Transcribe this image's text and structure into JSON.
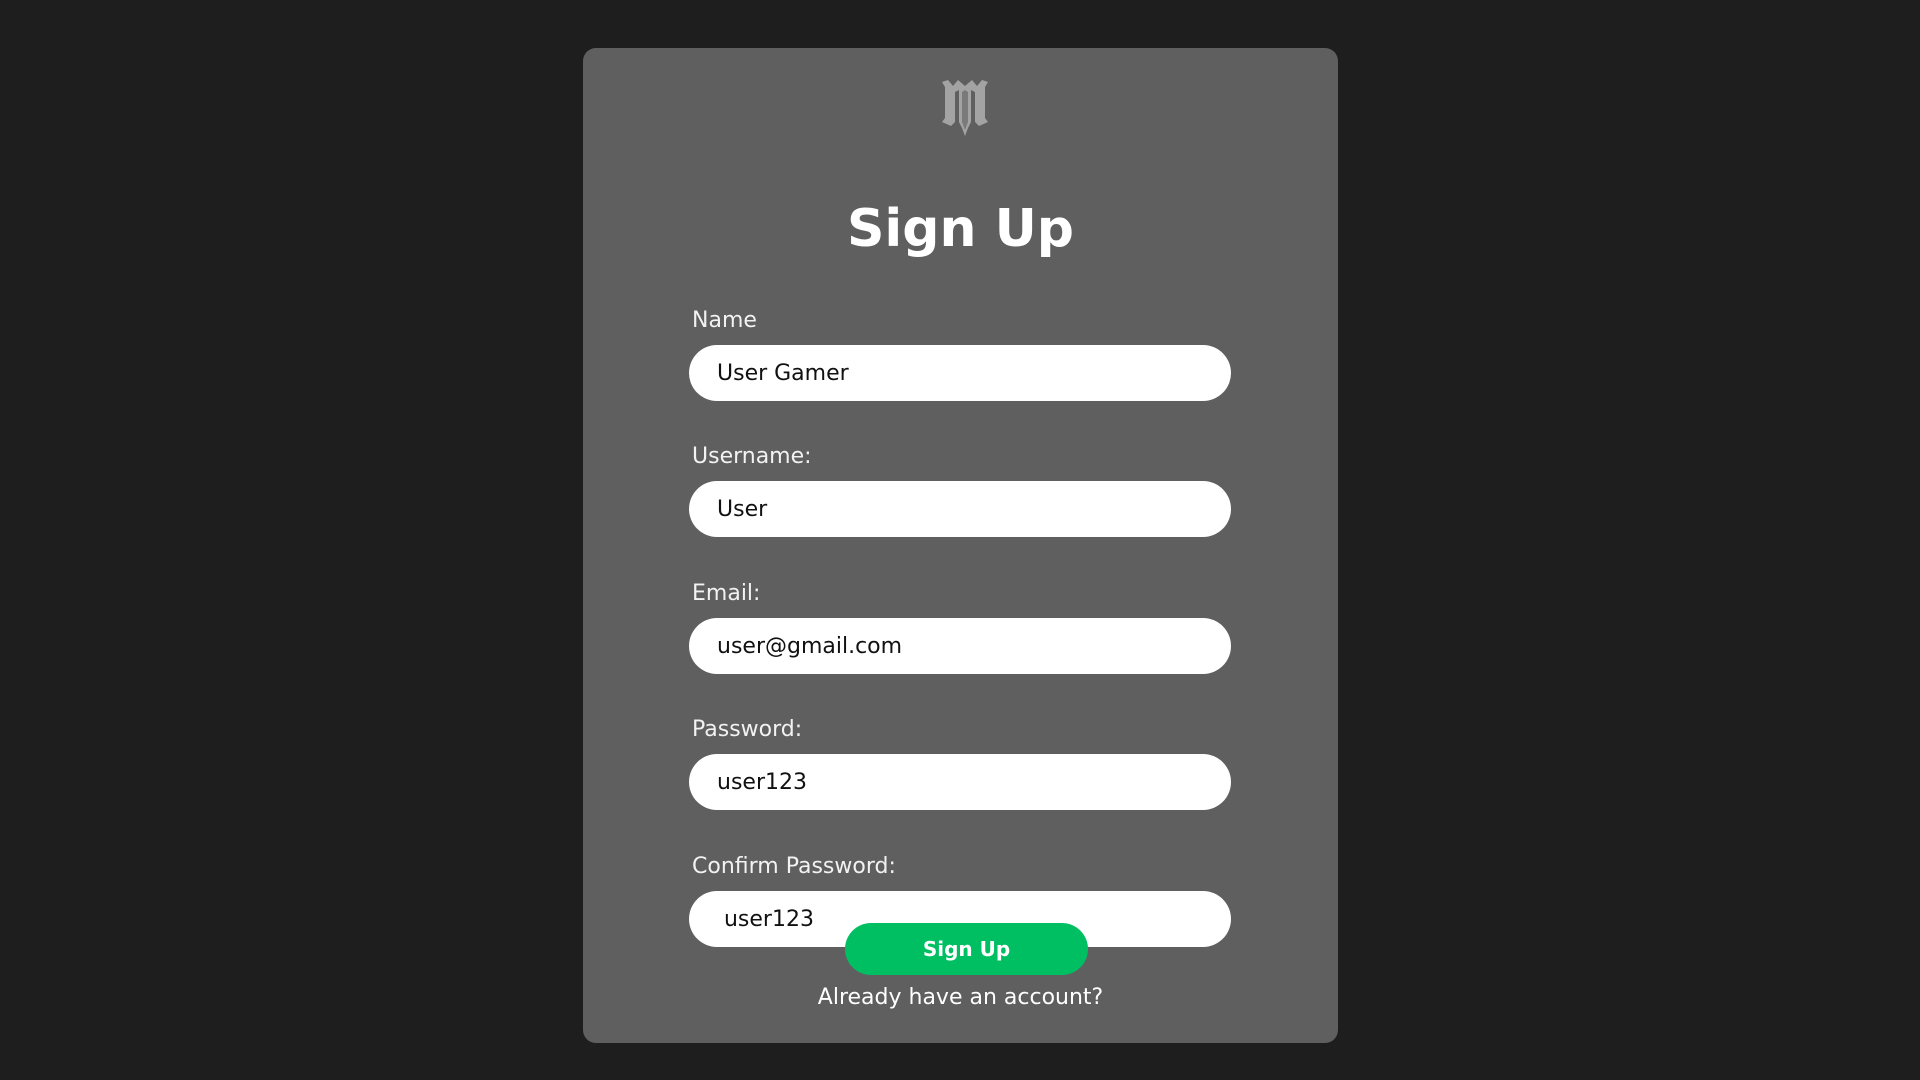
{
  "logo": {
    "icon": "m-crest-logo-icon",
    "color": "#a3a3a3"
  },
  "form": {
    "title": "Sign Up",
    "fields": [
      {
        "label": "Name",
        "value": "User Gamer"
      },
      {
        "label": "Username:",
        "value": "User"
      },
      {
        "label": "Email:",
        "value": "user@gmail.com"
      },
      {
        "label": "Password:",
        "value": "user123"
      },
      {
        "label": "Confirm Password:",
        "value": " user123"
      }
    ],
    "submit_label": "Sign Up",
    "login_link": "Already have an account?"
  },
  "colors": {
    "page_background": "#1e1e1e",
    "card_background": "#5f5f5f",
    "accent": "#00bf63"
  }
}
